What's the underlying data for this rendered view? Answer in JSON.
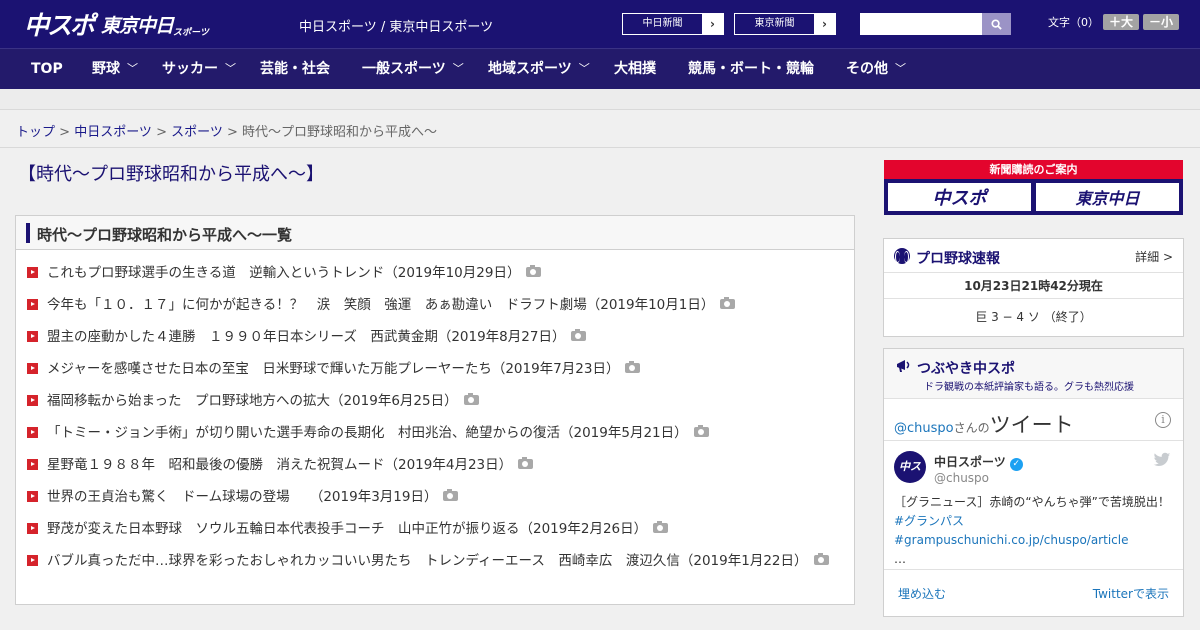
{
  "header": {
    "logo_main": "中スポ",
    "logo_tokyo": "東京中日",
    "logo_sub": "スポーツ",
    "site_links": "中日スポーツ / 東京中日スポーツ",
    "paper_buttons": [
      {
        "label": "中日新聞",
        "arrow": "›"
      },
      {
        "label": "東京新聞",
        "arrow": "›"
      }
    ],
    "search_placeholder": "",
    "fontsize_label": "文字（0）",
    "fontsize_plus": "＋大",
    "fontsize_minus": "－小"
  },
  "nav": [
    {
      "label": "TOP",
      "chevron": ""
    },
    {
      "label": "野球",
      "chevron": "﹀"
    },
    {
      "label": "サッカー",
      "chevron": "﹀"
    },
    {
      "label": "芸能・社会",
      "chevron": ""
    },
    {
      "label": "一般スポーツ",
      "chevron": "﹀"
    },
    {
      "label": "地域スポーツ",
      "chevron": "﹀"
    },
    {
      "label": "大相撲",
      "chevron": ""
    },
    {
      "label": "競馬・ボート・競輪",
      "chevron": ""
    },
    {
      "label": "その他",
      "chevron": "﹀"
    }
  ],
  "breadcrumb": {
    "items": [
      "トップ",
      "中日スポーツ",
      "スポーツ"
    ],
    "separator": " > ",
    "current": "時代～プロ野球昭和から平成へ～"
  },
  "page_title": "【時代～プロ野球昭和から平成へ～】",
  "list": {
    "heading": "時代～プロ野球昭和から平成へ～一覧",
    "articles": [
      "これもプロ野球選手の生きる道　逆輸入というトレンド（2019年10月29日）",
      "今年も「１０．１７」に何かが起きる！？　涙　笑顔　強運　あぁ勘違い　ドラフト劇場（2019年10月1日）",
      "盟主の座動かした４連勝　１９９０年日本シリーズ　西武黄金期（2019年8月27日）",
      "メジャーを感嘆させた日本の至宝　日米野球で輝いた万能プレーヤーたち（2019年7月23日）",
      "福岡移転から始まった　プロ野球地方への拡大（2019年6月25日）",
      "「トミー・ジョン手術」が切り開いた選手寿命の長期化　村田兆治、絶望からの復活（2019年5月21日）",
      "星野竜１９８８年　昭和最後の優勝　消えた祝賀ムード（2019年4月23日）",
      "世界の王貞治も驚く　ドーム球場の登場　　（2019年3月19日）",
      "野茂が変えた日本野球　ソウル五輪日本代表投手コーチ　山中正竹が振り返る（2019年2月26日）",
      "バブル真っただ中…球界を彩ったおしゃれカッコいい男たち　トレンディーエース　西崎幸広　渡辺久信（2019年1月22日）"
    ]
  },
  "subscribe": {
    "heading": "新聞購読のご案内",
    "logos": [
      "中スポ",
      "東京中日"
    ]
  },
  "baseball": {
    "title": "プロ野球速報",
    "detail": "詳細 >",
    "time": "10月23日21時42分現在",
    "score": "巨 3 − 4 ソ （終了）"
  },
  "tweets": {
    "title": "つぶやき中スポ",
    "subtitle": "ドラ観戦の本紙評論家も語る。グラも熱烈応援",
    "handle": "@chuspo",
    "handle_suffix": "さんの",
    "label": "ツイート",
    "account_name": "中日スポーツ",
    "screen_name": "@chuspo",
    "avatar_text": "中スポ",
    "text_plain": "［グラニュース］赤崎の“やんちゃ弾”で苦境脱出！",
    "text_link1": "#グランパス",
    "text_link2": "#grampus",
    "text_link3": "chunichi.co.jp/chuspo/article",
    "text_more": "…",
    "embed": "埋め込む",
    "view_on": "Twitterで表示"
  },
  "colors": {
    "navy": "#1b1272",
    "red": "#e3052d",
    "link": "#1b75bb"
  }
}
